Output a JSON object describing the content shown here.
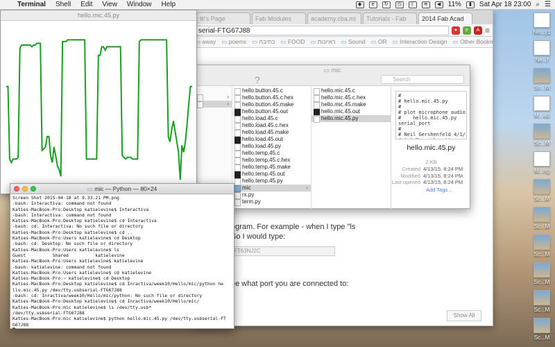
{
  "menubar": {
    "app_name": "Terminal",
    "items": [
      "Shell",
      "Edit",
      "View",
      "Window",
      "Help"
    ],
    "battery": "11%",
    "datetime": "Sat Apr 18  23:00"
  },
  "desktop_icons": [
    {
      "label": "Ne...y1",
      "kind": "file"
    },
    {
      "label": "Ne...f",
      "kind": "file"
    },
    {
      "label": "Sc...M",
      "kind": "img"
    },
    {
      "label": "M...ad",
      "kind": "file"
    },
    {
      "label": "Sc...M",
      "kind": "img"
    },
    {
      "label": "M...ng",
      "kind": "file"
    },
    {
      "label": "Sc...M",
      "kind": "img"
    },
    {
      "label": "Sc...M",
      "kind": "img"
    },
    {
      "label": "Sc...M",
      "kind": "img"
    },
    {
      "label": "Sc...M",
      "kind": "img"
    },
    {
      "label": "Sc...M",
      "kind": "img"
    },
    {
      "label": "Sc...M",
      "kind": "img"
    }
  ],
  "browser": {
    "tabs": [
      "tti's Page",
      "Fab Modules",
      "academy.cba.mi",
      "Tutorials - Fab",
      "2014 Fab Acad"
    ],
    "active_tab": 4,
    "url": "serial-FTG67J88",
    "bookmarks": [
      "away",
      "poems",
      "כתיבה",
      "FOOD",
      "ראיונות",
      "Sound",
      "OR",
      "Interaction Design"
    ],
    "other_bookmarks": "Other Bookmarks",
    "page_text_1": "ogram. For example - when I type \"ls",
    "page_text_2": "So I would type:",
    "code_snippet": "FT63NJ2C",
    "page_text_3": "ee what port you are connected to:",
    "show_all": "Show All"
  },
  "finder": {
    "title": "mic",
    "search_placeholder": "Search",
    "col1": [
      {
        "name": "hello.button.45.c",
        "kind": "c"
      },
      {
        "name": "hello.button.45.c.hex",
        "kind": "file"
      },
      {
        "name": "hello.button.45.make",
        "kind": "file"
      },
      {
        "name": "hello.button.45.out",
        "kind": "dark"
      },
      {
        "name": "hello.load.45.c",
        "kind": "c"
      },
      {
        "name": "hello.load.45.c.hex",
        "kind": "file"
      },
      {
        "name": "hello.load.45.make",
        "kind": "file"
      },
      {
        "name": "hello.load.45.out",
        "kind": "dark"
      },
      {
        "name": "hello.load.45.py",
        "kind": "file"
      },
      {
        "name": "hello.temp.45.c",
        "kind": "c"
      },
      {
        "name": "hello.temp.45.c.hex",
        "kind": "file"
      },
      {
        "name": "hello.temp.45.make",
        "kind": "file"
      },
      {
        "name": "hello.temp.45.out",
        "kind": "dark"
      },
      {
        "name": "hello.temp.45.py",
        "kind": "file"
      },
      {
        "name": "mic",
        "kind": "folder"
      },
      {
        "name": "rx.py",
        "kind": "file"
      },
      {
        "name": "term.py",
        "kind": "file"
      }
    ],
    "col1_selected": 14,
    "col2": [
      {
        "name": "hello.mic.45.c",
        "kind": "c"
      },
      {
        "name": "hello.mic.45.c.hex",
        "kind": "file"
      },
      {
        "name": "hello.mic.45.make",
        "kind": "file"
      },
      {
        "name": "hello.mic.45.out",
        "kind": "dark"
      },
      {
        "name": "hello.mic.45.py",
        "kind": "file"
      }
    ],
    "col2_selected": 4,
    "preview": {
      "code": "#\n# hello.mic.45.py\n#\n# plot microphone audio\n#    hello.mic.45.py\nserial_port\n#\n# Neil Gershenfeld 4/1/14\n# (c) Massachusetts\nInstitute of Technology",
      "filename": "hello.mic.45.py",
      "size": "2 KB",
      "created_label": "Created",
      "created": "4/13/15, 8:24 PM",
      "modified_label": "Modified",
      "modified": "4/13/15, 8:24 PM",
      "opened_label": "Last opened",
      "opened": "4/13/15, 8:24 PM",
      "add_tags": "Add Tags..."
    }
  },
  "plot": {
    "title": "hello.mic.45.py",
    "line_color": "#1a9e22"
  },
  "chart_data": {
    "type": "line",
    "series": [
      {
        "values": [
          0.62,
          0.62,
          0.2,
          0.18,
          0.2,
          0.2,
          0.2,
          0.21,
          0.84,
          0.86,
          0.86,
          0.86,
          0.86,
          0.86,
          0.86,
          0.85,
          0.86,
          0.86,
          0.87,
          0.87,
          0.87,
          0.25,
          0.26,
          0.27,
          0.33,
          0.33,
          0.22,
          0.18,
          0.27,
          0.22,
          0.16,
          0.14,
          0.1,
          0.88,
          0.88,
          0.88,
          0.89,
          0.89,
          0.89,
          0.89,
          0.89,
          0.89,
          0.89,
          0.89,
          0.89,
          0.89,
          0.89,
          0.2,
          0.2,
          0.2,
          0.2,
          0.2,
          0.2,
          0.2,
          0.8,
          0.8,
          0.85,
          0.85,
          0.83,
          0.85,
          0.85,
          0.85,
          0.85,
          0.85,
          0.85,
          0.85,
          0.85,
          0.85,
          0.22,
          0.21,
          0.2,
          0.21,
          0.21,
          0.21,
          0.2,
          0.2,
          0.2,
          0.2,
          0.88,
          0.89,
          0.89,
          0.89,
          0.89,
          0.89,
          0.89,
          0.89,
          0.89,
          0.89,
          0.89,
          0.89,
          0.89,
          0.89,
          0.89,
          0.89,
          0.89,
          0.33,
          0.3,
          0.37,
          0.42,
          0.36,
          0.3,
          0.24,
          0.08,
          0.28,
          0.24,
          0.3,
          0.4,
          0.52,
          0.62,
          0.62
        ]
      }
    ]
  },
  "terminal": {
    "title": "mic — Python — 80×24",
    "lines": [
      "Screen Shot 2015-04-18 at 9.33.21 PM.png",
      "-bash: Interactiva: command not found",
      "Katies-MacBook-Pro:Desktop katielevine$ Interactiva",
      "-bash: Interactiva: command not found",
      "Katies-MacBook-Pro:Desktop katielevine$ cd Interactiva",
      "-bash: cd: Interactiva: No such file or directory",
      "Katies-MacBook-Pro:Desktop katielevine$ cd ..",
      "Katies-MacBook-Pro:Users katielevine$ cd Desktop",
      "-bash: cd: Desktop: No such file or directory",
      "Katies-MacBook-Pro:Users katielevine$ ls",
      "Guest          Shared          katielevine",
      "Katies-MacBook-Pro:Users katielevine$ katielevine",
      "-bash: katielevine: command not found",
      "Katies-MacBook-Pro:Users katielevine$ cd katielevine",
      "Katies-MacBook-Pro:~ katielevine$ cd Desktop",
      "Katies-MacBook-Pro:Desktop katielevine$ cd Inractiva/week10/Hello/mic/python he",
      "llo.mic.45.py /dev/tty.usbserial-FTG67J88",
      "-bash: cd: Inractiva/week10/Hello/mic/python: No such file or directory",
      "Katies-MacBook-Pro:Desktop katielevine$ cd Inractiva/week10/Hello/mic/",
      "Katies-MacBook-Pro:mic katielevine$ ls /dev/tty.usb*",
      "/dev/tty.usbserial-FTG67J88",
      "Katies-MacBook-Pro:mic katielevine$ python hello.mic.45.py /dev/tty.usbserial-FT",
      "G67J88"
    ]
  }
}
